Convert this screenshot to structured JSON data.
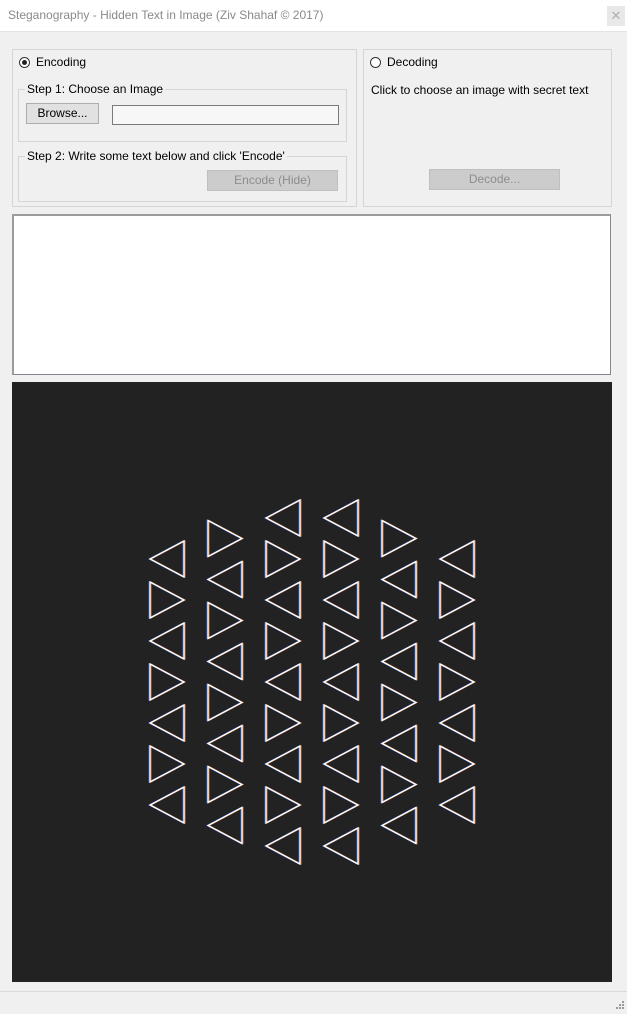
{
  "window": {
    "title": "Steganography - Hidden Text in Image (Ziv Shahaf © 2017)",
    "close_icon": "close-icon"
  },
  "encoding": {
    "radio_label": "Encoding",
    "selected": true,
    "step1_label": "Step 1: Choose an Image",
    "browse_label": "Browse...",
    "file_path_value": "",
    "step2_label": "Step 2: Write some text below and click 'Encode'",
    "encode_label": "Encode (Hide)"
  },
  "decoding": {
    "radio_label": "Decoding",
    "selected": false,
    "hint": "Click to choose an image with secret text",
    "decode_label": "Decode..."
  },
  "text_input": {
    "value": ""
  },
  "image_preview": {
    "description_icon": "flower-of-life-triangles-image",
    "background": "#222222"
  },
  "colors": {
    "window_bg": "#f0f0f0",
    "preview_bg": "#222222",
    "triangle_stroke": "#ffffff"
  }
}
